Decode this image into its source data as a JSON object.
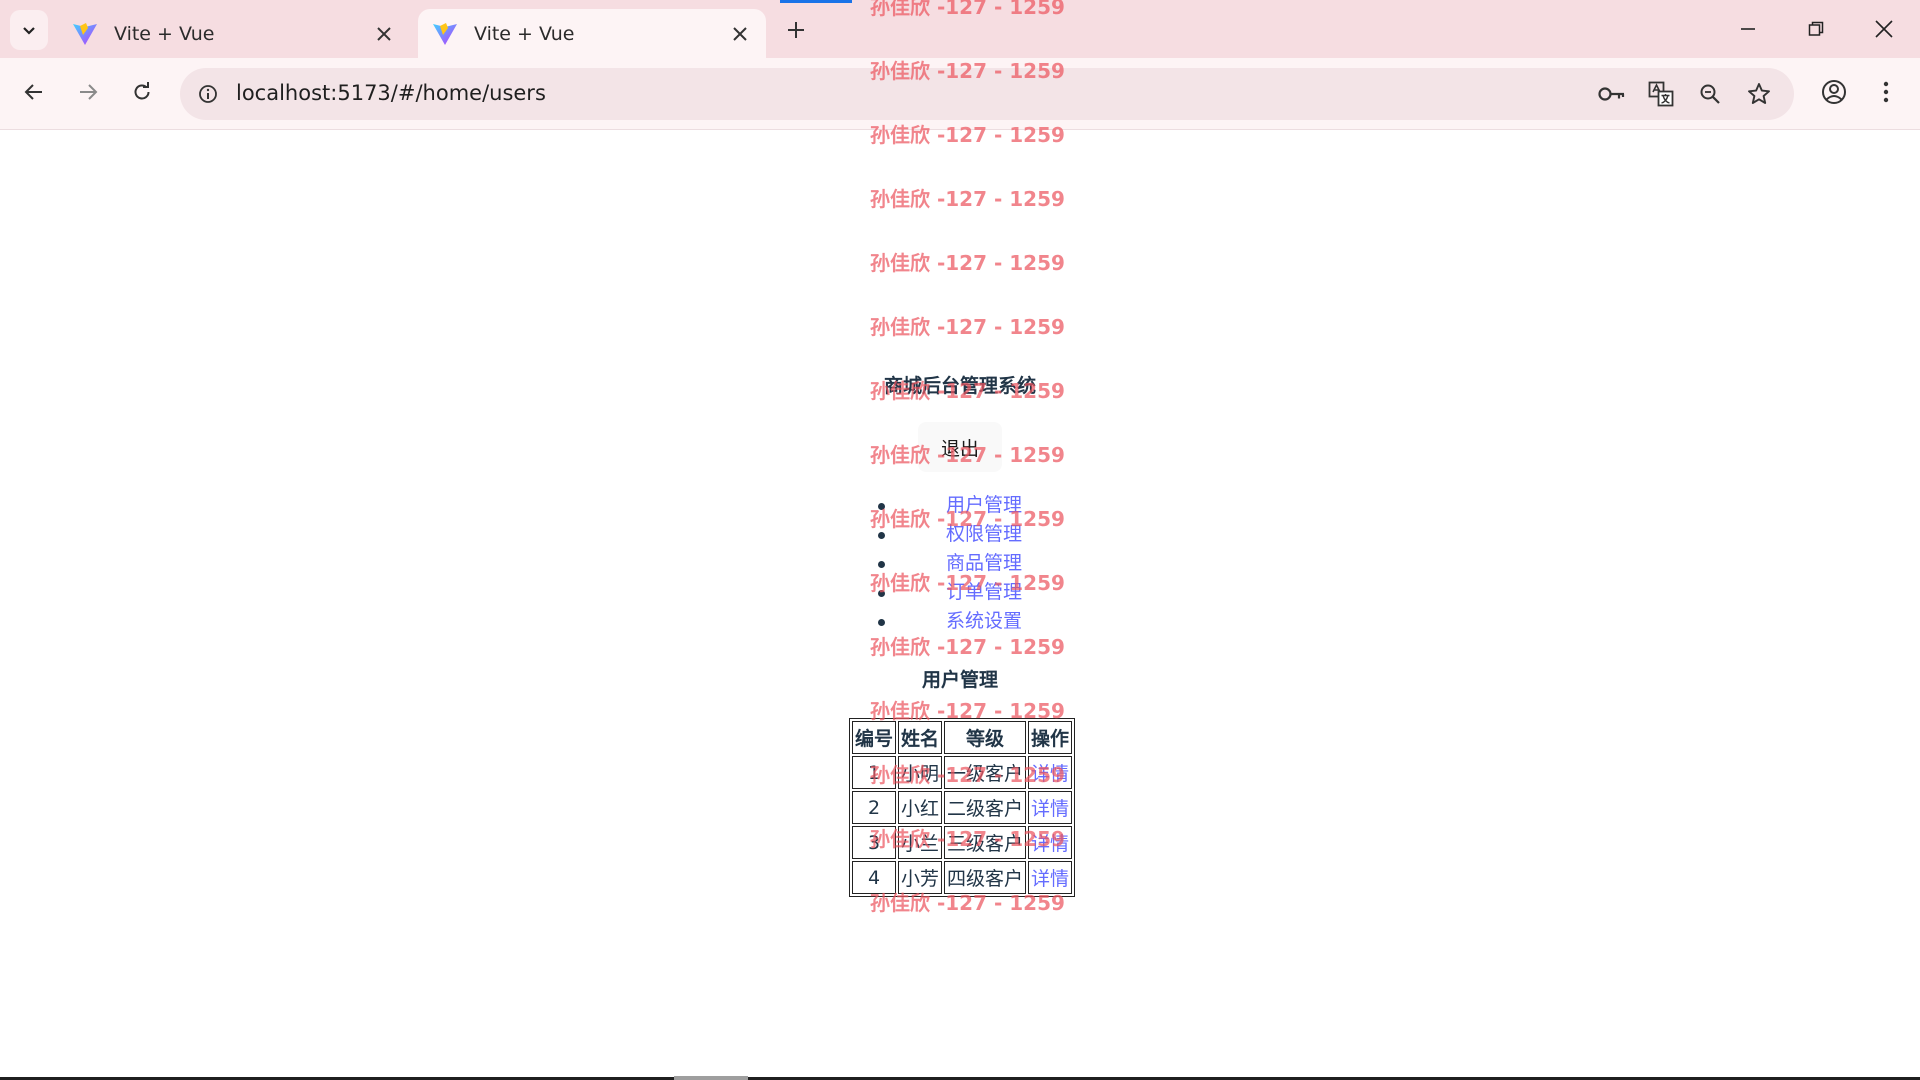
{
  "browser": {
    "tabs": [
      {
        "title": "Vite + Vue",
        "active": false
      },
      {
        "title": "Vite + Vue",
        "active": true
      }
    ],
    "url_host": "localhost",
    "url_rest": ":5173/#/home/users",
    "icons": [
      "tab-search-icon",
      "vite-favicon-icon",
      "close-icon",
      "plus-icon",
      "minimize-icon",
      "restore-icon",
      "close-window-icon",
      "back-icon",
      "forward-icon",
      "reload-icon",
      "site-info-icon",
      "key-icon",
      "translate-icon",
      "zoom-icon",
      "star-icon",
      "profile-icon",
      "more-icon"
    ],
    "accent_color": "#1a73e8",
    "chrome_color": "#f6dde1"
  },
  "app": {
    "title": "商城后台管理系统",
    "logout_label": "退出",
    "menu": [
      {
        "label": "用户管理"
      },
      {
        "label": "权限管理"
      },
      {
        "label": "商品管理"
      },
      {
        "label": "订单管理"
      },
      {
        "label": "系统设置"
      }
    ],
    "section_title": "用户管理",
    "table": {
      "headers": [
        "编号",
        "姓名",
        "等级",
        "操作"
      ],
      "rows": [
        {
          "id": "1",
          "name": "小明",
          "level": "一级客户",
          "action": "详情"
        },
        {
          "id": "2",
          "name": "小红",
          "level": "二级客户",
          "action": "详情"
        },
        {
          "id": "3",
          "name": "小兰",
          "level": "三级客户",
          "action": "详情"
        },
        {
          "id": "4",
          "name": "小芳",
          "level": "四级客户",
          "action": "详情"
        }
      ]
    },
    "link_color": "#646cff",
    "text_color": "#213547"
  },
  "watermark": {
    "text": "孙佳欣 -127 - 1259",
    "color": "#ec5660",
    "count": 17
  }
}
